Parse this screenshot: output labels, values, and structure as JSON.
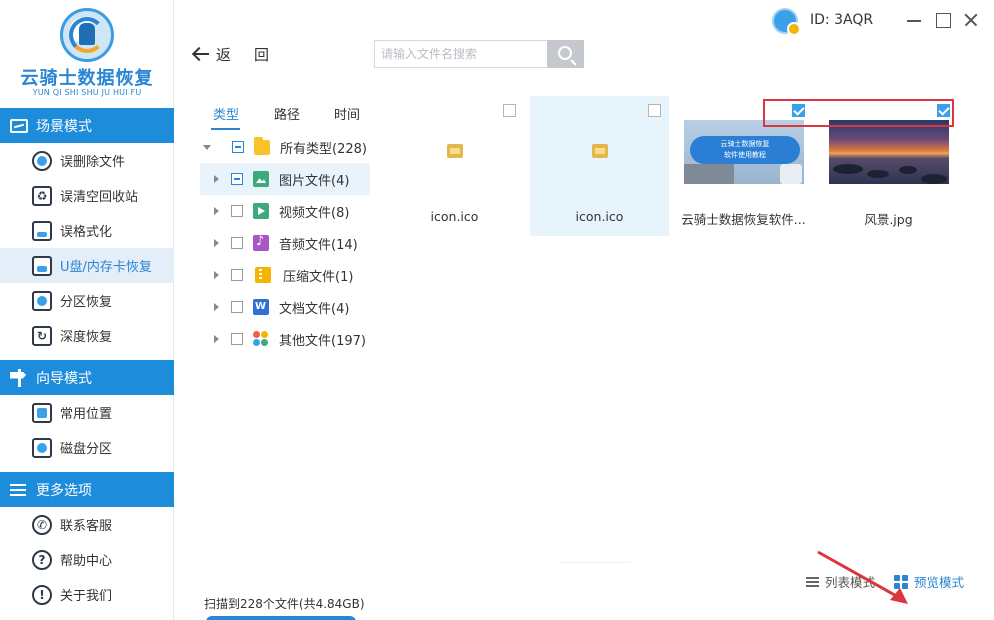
{
  "app": {
    "logo_title": "云骑士数据恢复",
    "logo_subtitle": "YUN QI SHI SHU JU HUI FU",
    "user_id": "ID: 3AQR"
  },
  "sidebar": {
    "sections": [
      {
        "title": "场景模式",
        "items": [
          {
            "label": "误删除文件",
            "active": false
          },
          {
            "label": "误清空回收站",
            "active": false
          },
          {
            "label": "误格式化",
            "active": false
          },
          {
            "label": "U盘/内存卡恢复",
            "active": true
          },
          {
            "label": "分区恢复",
            "active": false
          },
          {
            "label": "深度恢复",
            "active": false
          }
        ]
      },
      {
        "title": "向导模式",
        "items": [
          {
            "label": "常用位置",
            "active": false
          },
          {
            "label": "磁盘分区",
            "active": false
          }
        ]
      },
      {
        "title": "更多选项",
        "items": [
          {
            "label": "联系客服",
            "active": false
          },
          {
            "label": "帮助中心",
            "active": false
          },
          {
            "label": "关于我们",
            "active": false
          }
        ]
      }
    ]
  },
  "toolbar": {
    "back_label": "返",
    "back_label_2": "回",
    "search_placeholder": "请输入文件名搜索",
    "search_value": ""
  },
  "filter": {
    "tabs": [
      {
        "label": "类型",
        "active": true
      },
      {
        "label": "路径",
        "active": false
      },
      {
        "label": "时间",
        "active": false
      }
    ],
    "tree": [
      {
        "label": "所有类型(228)",
        "icon": "folder-icon",
        "expanded": true,
        "check": "partial",
        "selected": false
      },
      {
        "label": "图片文件(4)",
        "icon": "image-icon",
        "expanded": false,
        "check": "partial",
        "selected": true
      },
      {
        "label": "视频文件(8)",
        "icon": "video-icon",
        "expanded": false,
        "check": "none",
        "selected": false
      },
      {
        "label": "音频文件(14)",
        "icon": "audio-icon",
        "expanded": false,
        "check": "none",
        "selected": false
      },
      {
        "label": "压缩文件(1)",
        "icon": "zip-icon",
        "expanded": false,
        "check": "none",
        "selected": false
      },
      {
        "label": "文档文件(4)",
        "icon": "doc-icon",
        "expanded": false,
        "check": "none",
        "selected": false
      },
      {
        "label": "其他文件(197)",
        "icon": "other-icon",
        "expanded": false,
        "check": "none",
        "selected": false
      }
    ]
  },
  "files": [
    {
      "name": "icon.ico",
      "checked": false,
      "hover": false,
      "thumb": "file-icon"
    },
    {
      "name": "icon.ico",
      "checked": false,
      "hover": true,
      "thumb": "file-icon"
    },
    {
      "name": "云骑士数据恢复软件...",
      "checked": true,
      "hover": false,
      "thumb": "tutorial-image",
      "thumb_text_line1": "云骑士数据恢复",
      "thumb_text_line2": "软件使用教程"
    },
    {
      "name": "风景.jpg",
      "checked": true,
      "hover": false,
      "thumb": "landscape-image"
    }
  ],
  "footer": {
    "scan_summary": "扫描到228个文件(共4.84GB)",
    "view_list_label": "列表模式",
    "view_preview_label": "预览模式"
  },
  "colors": {
    "accent": "#1d8cdb",
    "annotation_red": "#d9363e"
  }
}
